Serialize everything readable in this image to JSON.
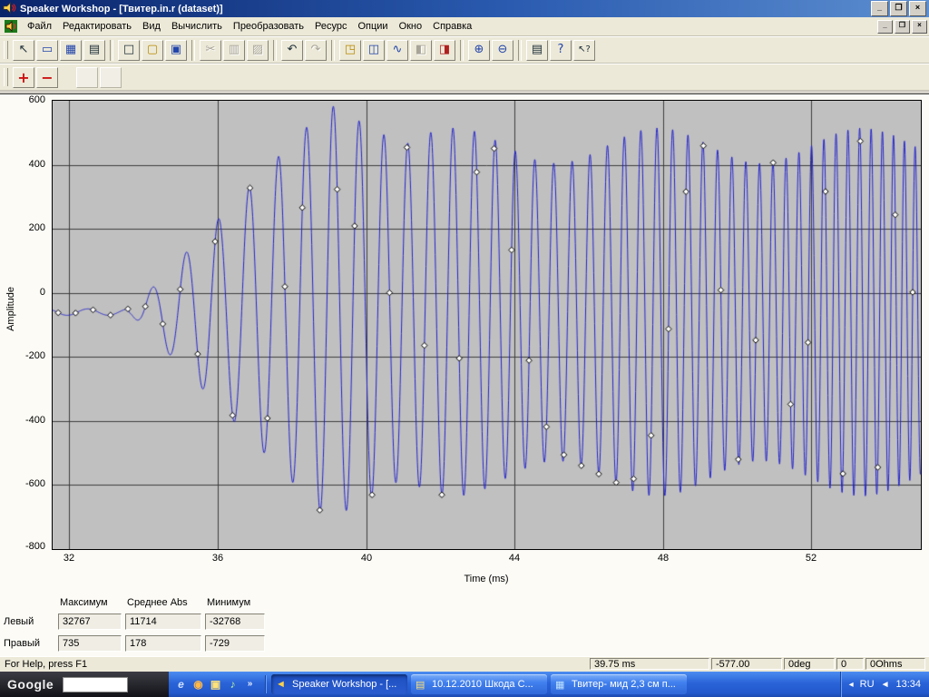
{
  "window": {
    "title": "Speaker Workshop - [Твитер.in.r (dataset)]",
    "controls": {
      "minimize": "_",
      "restore": "❐",
      "close": "×"
    }
  },
  "mdi_controls": {
    "minimize": "_",
    "restore": "❐",
    "close": "×"
  },
  "menu": {
    "items": [
      "Файл",
      "Редактировать",
      "Вид",
      "Вычислить",
      "Преобразовать",
      "Ресурс",
      "Опции",
      "Окно",
      "Справка"
    ]
  },
  "toolbar": {
    "buttons": [
      {
        "name": "pointer",
        "glyph": "↖"
      },
      {
        "name": "measure-mode",
        "glyph": "▭"
      },
      {
        "name": "grid-mode",
        "glyph": "▦"
      },
      {
        "name": "keyboard-entry",
        "glyph": "▤"
      },
      {
        "name": "new-file",
        "glyph": "□"
      },
      {
        "name": "open-file",
        "glyph": "▢"
      },
      {
        "name": "save-file",
        "glyph": "▣"
      },
      {
        "name": "cut",
        "glyph": "✂",
        "disabled": true
      },
      {
        "name": "copy",
        "glyph": "▥",
        "disabled": true
      },
      {
        "name": "paste",
        "glyph": "▨",
        "disabled": true
      },
      {
        "name": "undo",
        "glyph": "↶"
      },
      {
        "name": "redo",
        "glyph": "↷",
        "disabled": true
      },
      {
        "name": "import-chart",
        "glyph": "◳"
      },
      {
        "name": "chart-line",
        "glyph": "◫"
      },
      {
        "name": "chart-wave",
        "glyph": "∿"
      },
      {
        "name": "chart-compare",
        "glyph": "◧",
        "disabled": true
      },
      {
        "name": "chart-marker",
        "glyph": "◨"
      },
      {
        "name": "zoom-in",
        "glyph": "⊕"
      },
      {
        "name": "zoom-out",
        "glyph": "⊖"
      },
      {
        "name": "print",
        "glyph": "▤"
      },
      {
        "name": "help",
        "glyph": "?"
      },
      {
        "name": "context-help",
        "glyph": "↖?"
      }
    ]
  },
  "edit_toolbar": {
    "add": "+",
    "remove": "−"
  },
  "chart": {
    "ylabel": "Amplitude",
    "xlabel": "Time (ms)"
  },
  "chart_data": {
    "type": "line",
    "title": "",
    "xlabel": "Time (ms)",
    "ylabel": "Amplitude",
    "t_min": 31.55,
    "t_max": 54.95,
    "y_min": -800,
    "y_max": 600,
    "x_ticks": [
      32,
      36,
      40,
      44,
      48,
      52
    ],
    "y_ticks": [
      600,
      400,
      200,
      0,
      -200,
      -400,
      -600,
      -800
    ],
    "x_gridlines": [
      32,
      36,
      40,
      44,
      48,
      52
    ],
    "y_gridlines": [
      400,
      200,
      0,
      -200,
      -400,
      -600
    ],
    "plot_bg": "#c0c0c0",
    "grid_color": "#3c3c3c",
    "line_color": "#2222cc",
    "marker_start": 31.7,
    "marker_step": 0.47,
    "signal": {
      "description": "Tweeter time-domain record: flat baseline near -55..-60 until ~33.6 ms, then a swept sine burst growing to roughly +590/-710 peak by ~39 ms, settling to about ±520 around the -60 offset while frequency rises from ~1.05 cycles/ms at 34 ms (period ~0.95 ms) to ~3 cycles/ms at 53 ms (period ~0.33 ms); white diamond sample markers about every 0.47 ms.",
      "baseline": -60,
      "noise_amp": 10,
      "flat_end": 33.6,
      "ramp_end": 39.0,
      "peak_amp": 650,
      "settle_end": 41.0,
      "settle_amp": 520,
      "amp_wobble": 55,
      "wobble_period": 5.5,
      "f0": 1.05,
      "sweep_t0": 34.0,
      "sweep_doubling": 12.0
    }
  },
  "stats": {
    "headers": [
      "Максимум",
      "Среднее Abs",
      "Минимум"
    ],
    "rows": [
      {
        "label": "Левый",
        "values": [
          "32767",
          "11714",
          "-32768"
        ]
      },
      {
        "label": "Правый",
        "values": [
          "735",
          "178",
          "-729"
        ]
      }
    ]
  },
  "status": {
    "help": "For Help, press F1",
    "fields": [
      "39.75  ms",
      "-577.00",
      "0deg",
      "0",
      "0Ohms"
    ]
  },
  "taskbar": {
    "google_label": "Google",
    "search_placeholder": "",
    "quick_launch": [
      {
        "name": "internet-explorer",
        "glyph": "e"
      },
      {
        "name": "browser",
        "glyph": "◉"
      },
      {
        "name": "folder",
        "glyph": "▣"
      },
      {
        "name": "media-player",
        "glyph": "♪"
      },
      {
        "name": "overflow-chevron",
        "glyph": "»"
      }
    ],
    "buttons": [
      {
        "label": "Speaker Workshop - [...",
        "icon": "◄",
        "active": true
      },
      {
        "label": "10.12.2010 Шкода С...",
        "icon": "▤",
        "active": false
      },
      {
        "label": "Твитер- мид 2,3 см п...",
        "icon": "▦",
        "active": false
      }
    ],
    "tray": {
      "chevron": "◂",
      "lang": "RU",
      "volume_icon": "◄",
      "time": "13:34"
    }
  },
  "colors": {
    "titlebar_blue": "#0a246a",
    "taskbar_blue": "#2a63d8",
    "waveform_blue": "#2222cc",
    "plot_background": "#c0c0c0",
    "chrome_beige": "#ece9d8"
  }
}
